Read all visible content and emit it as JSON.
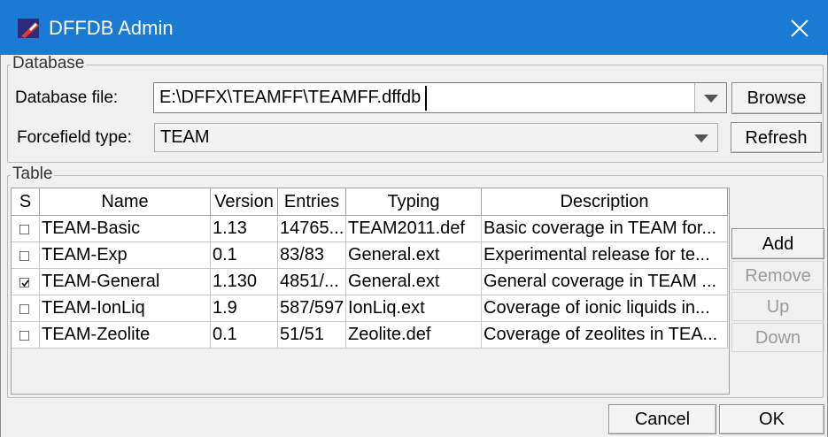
{
  "window": {
    "title": "DFFDB Admin",
    "titlebar_color": "#1a7ad4",
    "icons": {
      "app": "dffdb-app-icon",
      "close": "close-icon"
    }
  },
  "database_group": {
    "title": "Database",
    "db_file_label": "Database file:",
    "db_file_value": "E:\\DFFX\\TEAMFF\\TEAMFF.dffdb",
    "browse_label": "Browse",
    "ff_type_label": "Forcefield type:",
    "ff_type_value": "TEAM",
    "refresh_label": "Refresh"
  },
  "table_group": {
    "title": "Table",
    "columns": [
      "S",
      "Name",
      "Version",
      "Entries",
      "Typing",
      "Description"
    ],
    "rows": [
      {
        "checked": false,
        "name": "TEAM-Basic",
        "version": "1.13",
        "entries": "14765...",
        "typing": "TEAM2011.def",
        "description": "Basic coverage in TEAM for..."
      },
      {
        "checked": false,
        "name": "TEAM-Exp",
        "version": "0.1",
        "entries": "83/83",
        "typing": "General.ext",
        "description": "Experimental release for te..."
      },
      {
        "checked": true,
        "name": "TEAM-General",
        "version": "1.130",
        "entries": "4851/...",
        "typing": "General.ext",
        "description": "General coverage in TEAM ..."
      },
      {
        "checked": false,
        "name": "TEAM-IonLiq",
        "version": "1.9",
        "entries": "587/597",
        "typing": "IonLiq.ext",
        "description": "Coverage of ionic liquids in..."
      },
      {
        "checked": false,
        "name": "TEAM-Zeolite",
        "version": "0.1",
        "entries": "51/51",
        "typing": "Zeolite.def",
        "description": "Coverage of zeolites in TEA..."
      }
    ],
    "buttons": {
      "add": {
        "label": "Add",
        "enabled": true
      },
      "remove": {
        "label": "Remove",
        "enabled": false
      },
      "up": {
        "label": "Up",
        "enabled": false
      },
      "down": {
        "label": "Down",
        "enabled": false
      }
    }
  },
  "footer": {
    "cancel_label": "Cancel",
    "ok_label": "OK"
  }
}
